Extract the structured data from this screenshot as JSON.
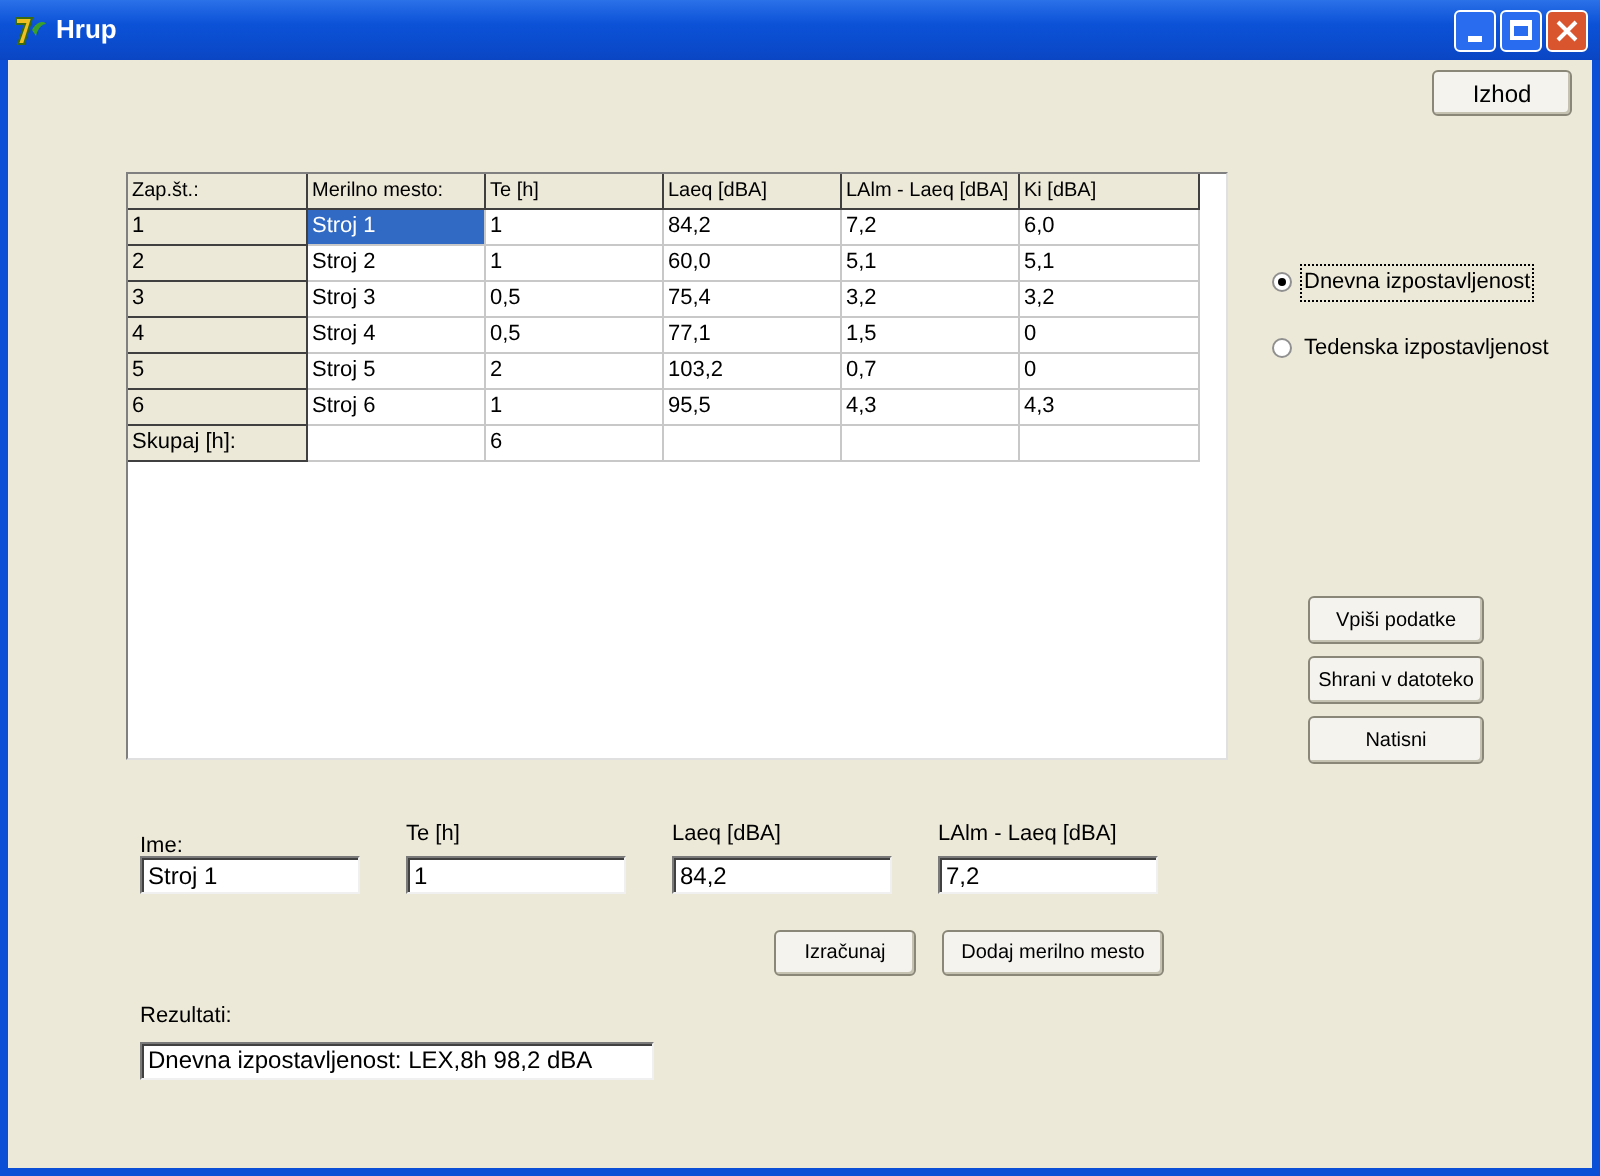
{
  "window": {
    "title": "Hrup"
  },
  "exit_button": "Izhod",
  "table": {
    "columns": [
      "Zap.št.:",
      "Merilno mesto:",
      "Te [h]",
      "Laeq [dBA]",
      "LAlm - Laeq [dBA]",
      "Ki [dBA]"
    ],
    "rows": [
      {
        "cells": [
          "1",
          "Stroj 1",
          "1",
          "84,2",
          "7,2",
          "6,0"
        ],
        "selected": true
      },
      {
        "cells": [
          "2",
          "Stroj 2",
          "1",
          "60,0",
          "5,1",
          "5,1"
        ],
        "selected": false
      },
      {
        "cells": [
          "3",
          "Stroj 3",
          "0,5",
          "75,4",
          "3,2",
          "3,2"
        ],
        "selected": false
      },
      {
        "cells": [
          "4",
          "Stroj 4",
          "0,5",
          "77,1",
          "1,5",
          "0"
        ],
        "selected": false
      },
      {
        "cells": [
          "5",
          "Stroj 5",
          "2",
          "103,2",
          "0,7",
          "0"
        ],
        "selected": false
      },
      {
        "cells": [
          "6",
          "Stroj 6",
          "1",
          "95,5",
          "4,3",
          "4,3"
        ],
        "selected": false
      }
    ],
    "total": {
      "label": "Skupaj [h]:",
      "te": "6"
    }
  },
  "exposure": [
    {
      "label": "Dnevna izpostavljenost",
      "selected": true
    },
    {
      "label": "Tedenska izpostavljenost",
      "selected": false
    }
  ],
  "side_buttons": [
    "Vpiši podatke",
    "Shrani v datoteko",
    "Natisni"
  ],
  "fields": [
    {
      "label": "Ime:",
      "value": "Stroj 1"
    },
    {
      "label": "Te [h]",
      "value": "1"
    },
    {
      "label": "Laeq  [dBA]",
      "value": "84,2"
    },
    {
      "label": "LAlm - Laeq  [dBA]",
      "value": "7,2"
    }
  ],
  "action_buttons": [
    "Izračunaj",
    "Dodaj merilno mesto"
  ],
  "results": {
    "label": "Rezultati:",
    "value": "Dnevna izpostavljenost: LEX,8h 98,2 dBA"
  }
}
